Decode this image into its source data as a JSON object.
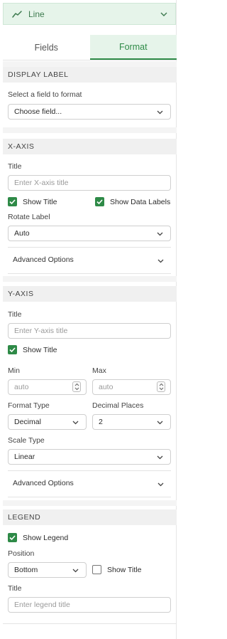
{
  "chart_type": {
    "label": "Line",
    "icon": "line-chart-icon"
  },
  "tabs": {
    "fields": "Fields",
    "format": "Format",
    "active": "Format"
  },
  "display_label": {
    "header": "DISPLAY LABEL",
    "select_label": "Select a field to format",
    "select_value": "Choose field..."
  },
  "x_axis": {
    "header": "X-AXIS",
    "title_label": "Title",
    "title_placeholder": "Enter X-axis title",
    "show_title_label": "Show Title",
    "show_title_checked": true,
    "show_data_labels_label": "Show Data Labels",
    "show_data_labels_checked": true,
    "rotate_label": "Rotate Label",
    "rotate_value": "Auto",
    "advanced_label": "Advanced Options"
  },
  "y_axis": {
    "header": "Y-AXIS",
    "title_label": "Title",
    "title_placeholder": "Enter Y-axis title",
    "show_title_label": "Show Title",
    "show_title_checked": true,
    "min_label": "Min",
    "min_placeholder": "auto",
    "max_label": "Max",
    "max_placeholder": "auto",
    "format_type_label": "Format Type",
    "format_type_value": "Decimal",
    "decimal_places_label": "Decimal Places",
    "decimal_places_value": "2",
    "scale_type_label": "Scale Type",
    "scale_type_value": "Linear",
    "advanced_label": "Advanced Options"
  },
  "legend": {
    "header": "LEGEND",
    "show_legend_label": "Show Legend",
    "show_legend_checked": true,
    "position_label": "Position",
    "position_value": "Bottom",
    "show_title_label": "Show Title",
    "show_title_checked": false,
    "title_label": "Title",
    "title_placeholder": "Enter legend title"
  },
  "colors": {
    "accent": "#2e8a47",
    "accent_bg": "#e6f4ea"
  }
}
